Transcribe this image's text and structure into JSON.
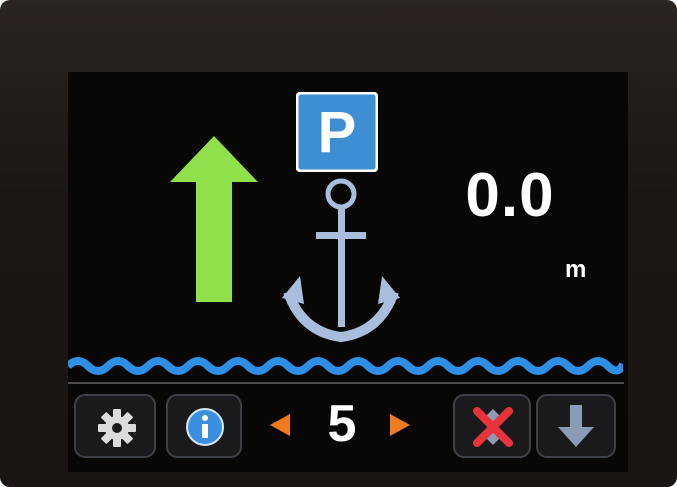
{
  "display": {
    "parking_letter": "P",
    "distance_value": "0.0",
    "distance_unit": "m",
    "count_value": "5"
  },
  "icons": {
    "direction": "up-arrow-icon",
    "parking": "parking-sign-icon",
    "anchor": "anchor-icon",
    "settings": "gear-icon",
    "info": "info-icon",
    "previous": "arrow-left-icon",
    "next": "arrow-right-icon",
    "cancel": "cancel-icon",
    "down": "arrow-down-icon"
  },
  "colors": {
    "arrow_green": "#8fe04a",
    "parking_blue": "#3e8ed4",
    "anchor_blue": "#9fb6d6",
    "water_blue": "#2d8fe6",
    "nav_orange": "#f07a1e",
    "cancel_red": "#e8333a"
  }
}
